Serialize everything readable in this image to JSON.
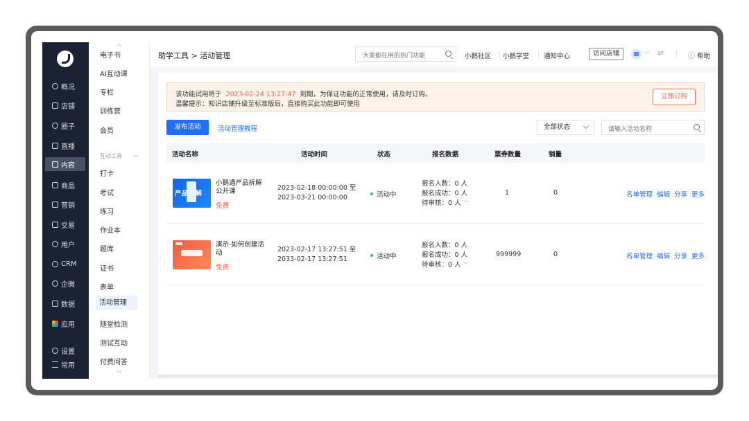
{
  "nav": {
    "items": [
      {
        "label": "概况",
        "icon": "chart-pie-icon"
      },
      {
        "label": "店铺",
        "icon": "store-icon"
      },
      {
        "label": "圈子",
        "icon": "group-icon"
      },
      {
        "label": "直播",
        "icon": "live-icon"
      },
      {
        "label": "内容",
        "icon": "content-icon",
        "active": true
      },
      {
        "label": "商品",
        "icon": "goods-icon"
      },
      {
        "label": "营销",
        "icon": "megaphone-icon"
      },
      {
        "label": "交易",
        "icon": "trade-icon"
      },
      {
        "label": "用户",
        "icon": "user-icon"
      },
      {
        "label": "CRM",
        "icon": "crm-icon"
      },
      {
        "label": "企微",
        "icon": "wecom-icon"
      },
      {
        "label": "数据",
        "icon": "data-icon"
      },
      {
        "label": "应用",
        "icon": "apps-icon"
      },
      {
        "label": "设置",
        "icon": "gear-icon"
      },
      {
        "label": "常用",
        "icon": "list-icon"
      }
    ]
  },
  "submenu": {
    "items_top": [
      "电子书",
      "AI互动课",
      "专栏",
      "训练营",
      "会员"
    ],
    "group_label": "互动工具",
    "items_group": [
      "打卡",
      "考试",
      "练习",
      "作业本",
      "题库",
      "证书",
      "表单",
      "活动管理",
      "随堂检测",
      "测试互动",
      "付费问答"
    ],
    "active": "活动管理"
  },
  "header": {
    "breadcrumb": "助学工具 > 活动管理",
    "search_placeholder": "大家都在用的热门功能",
    "links": [
      "小鹅社区",
      "小鹅学堂",
      "通知中心"
    ],
    "visit_store": "访问店铺",
    "help": "帮助"
  },
  "notice": {
    "line1_prefix": "该功能试用将于",
    "expire_date": "2023-02-24 13:27:47",
    "line1_suffix": "到期，为保证功能的正常使用，请及时订购。",
    "line2": "温馨提示：知识店铺升级至标准版后，直接购买此功能即可使用",
    "buy_button": "立即订购"
  },
  "toolbar": {
    "publish": "发布活动",
    "tutorial": "活动管理教程",
    "status_select": "全部状态",
    "name_search_placeholder": "请输入活动名称"
  },
  "table": {
    "headers": [
      "活动名称",
      "活动时间",
      "状态",
      "报名数据",
      "票券数量",
      "销量"
    ],
    "rows": [
      {
        "title": "小鹅通产品拆解公开课",
        "price": "免费",
        "time_start": "2023-02-18 00:00:00 至",
        "time_end": "2023-03-21 00:00:00",
        "status": "活动中",
        "signup": "报名人数：0 人",
        "success": "报名成功：0 人",
        "pending": "待审核：0 人",
        "tickets": "1",
        "sales": "0",
        "actions": [
          "名单管理",
          "编辑",
          "分享",
          "更多"
        ]
      },
      {
        "title": "演示-如何创建活动",
        "price": "免费",
        "time_start": "2023-02-17 13:27:51 至",
        "time_end": "2033-02-17 13:27:51",
        "status": "活动中",
        "signup": "报名人数：0 人",
        "success": "报名成功：0 人",
        "pending": "待审核：0 人",
        "tickets": "999999",
        "sales": "0",
        "actions": [
          "名单管理",
          "编辑",
          "分享",
          "更多"
        ]
      }
    ]
  },
  "colors": {
    "primary": "#1f6fff",
    "accent": "#f26b51",
    "nav_bg": "#1b2234"
  }
}
